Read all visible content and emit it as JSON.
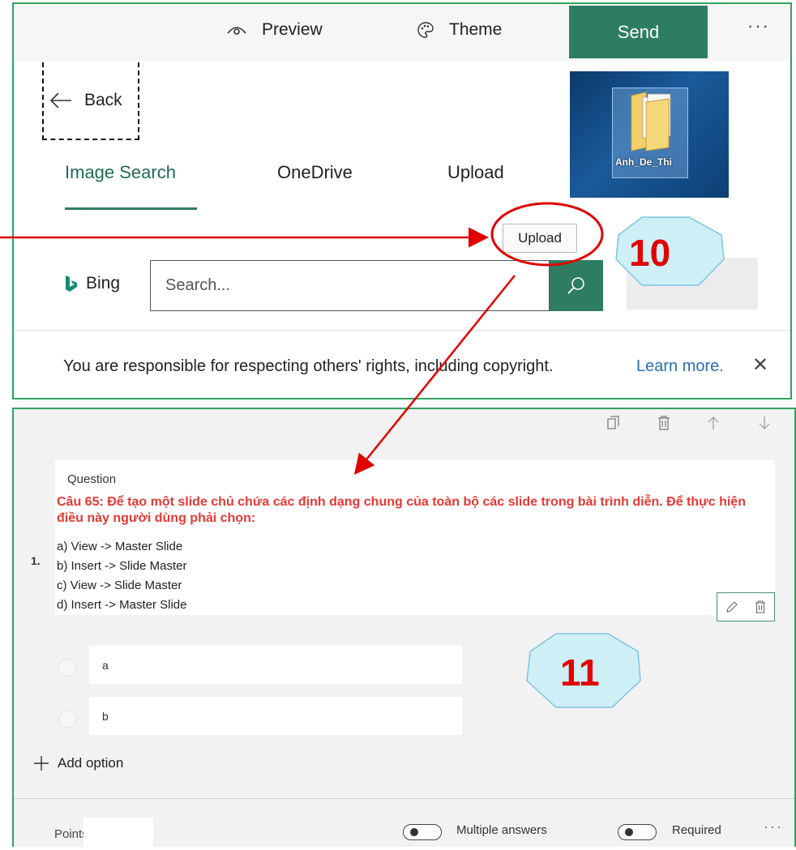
{
  "toolbar": {
    "preview_label": "Preview",
    "theme_label": "Theme",
    "send_label": "Send",
    "more": "···"
  },
  "image_picker": {
    "back_label": "Back",
    "tabs": [
      "Image Search",
      "OneDrive",
      "Upload"
    ],
    "upload_tooltip": "Upload",
    "folder_label": "Anh_De_Thi",
    "bing_label": "Bing",
    "search_placeholder": "Search...",
    "copyright_notice": "You are responsible for respecting others' rights, including copyright.",
    "learn_more": "Learn more.",
    "close": "✕"
  },
  "question": {
    "number": "1.",
    "label": "Question",
    "text_red": "Câu 65: Để tạo một slide chủ chứa các định dạng chung của toàn bộ các slide trong bài trình diễn. Để thực hiện điều này người dùng phải chọn:",
    "lines": [
      "a) View -> Master Slide",
      "b) Insert -> Slide Master",
      "c) View -> Slide Master",
      "d) Insert -> Master Slide"
    ],
    "options": [
      "a",
      "b"
    ],
    "add_option_label": "Add option",
    "points_label": "Points:",
    "multiple_answers_label": "Multiple answers",
    "required_label": "Required",
    "more": "···"
  },
  "annotations": {
    "step_a": "10",
    "step_b": "11"
  },
  "colors": {
    "accent": "#2e7d63",
    "frame": "#2fa35f",
    "annotation_red": "#e00000",
    "badge_fill": "#cdeff5"
  }
}
